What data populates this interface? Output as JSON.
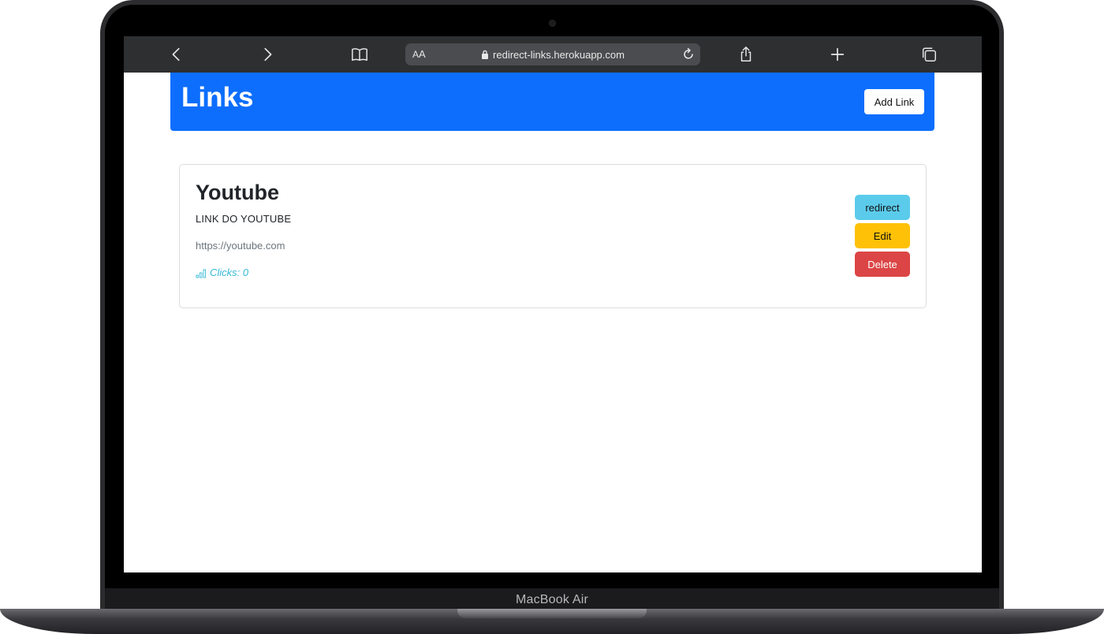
{
  "device": {
    "model_label": "MacBook Air"
  },
  "browser": {
    "reader_label_small": "A",
    "reader_label_big": "A",
    "url": "redirect-links.herokuapp.com",
    "icons": [
      "back-icon",
      "forward-icon",
      "bookmarks-icon",
      "lock-icon",
      "reload-icon",
      "share-icon",
      "new-tab-icon",
      "tabs-icon"
    ]
  },
  "header": {
    "title": "Links",
    "add_button": "Add Link"
  },
  "links": [
    {
      "title": "Youtube",
      "description": "LINK DO YOUTUBE",
      "url": "https://youtube.com",
      "clicks_label": "Clicks: 0",
      "actions": {
        "redirect": "redirect",
        "edit": "Edit",
        "delete": "Delete"
      }
    }
  ],
  "colors": {
    "primary": "#0d6efd",
    "info": "#5bcbeb",
    "warning": "#ffc107",
    "danger": "#dc4545",
    "toolbar": "#2d2f31"
  }
}
